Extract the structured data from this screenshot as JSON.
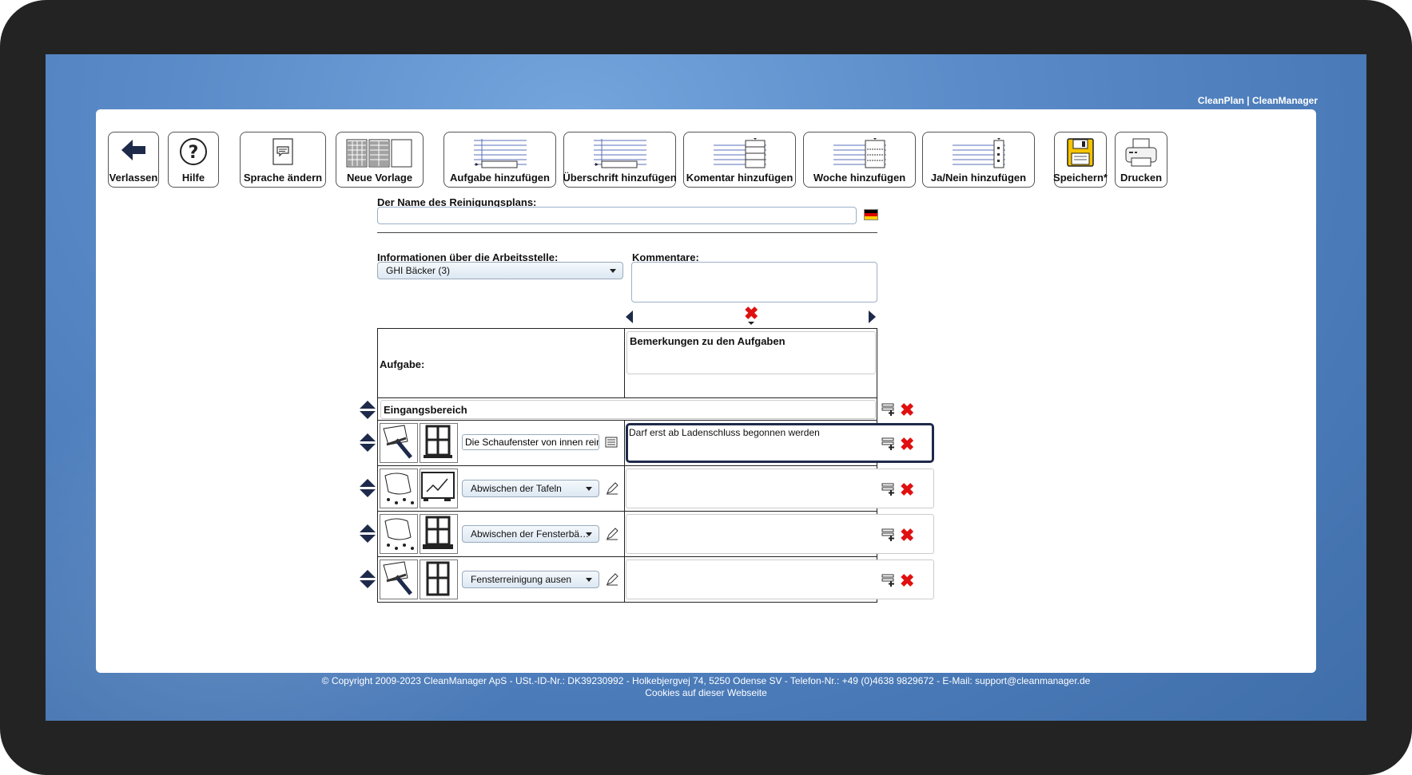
{
  "brand": "CleanPlan | CleanManager",
  "toolbar": {
    "leave": "Verlassen",
    "help": "Hilfe",
    "language": "Sprache ändern",
    "template": "Neue Vorlage",
    "add_task": "Aufgabe hinzufügen",
    "add_heading": "Überschrift hinzufügen",
    "add_comment": "Komentar hinzufügen",
    "add_week": "Woche hinzufügen",
    "add_yesno": "Ja/Nein hinzufügen",
    "save": "Speichern*",
    "print": "Drucken"
  },
  "form": {
    "plan_name_label": "Der Name des Reinigungsplans:",
    "plan_name_value": "",
    "workplace_label": "Informationen über die Arbeitsstelle:",
    "workplace_value": "GHI Bäcker (3)",
    "comments_label": "Kommentare:",
    "comments_value": ""
  },
  "grid": {
    "task_header": "Aufgabe:",
    "remarks_header": "Bemerkungen zu den Aufgaben",
    "section_title": "Eingangsbereich",
    "tasks": [
      {
        "name": "Die Schaufenster von innen reinig",
        "type": "text",
        "remark": "Darf erst ab Ladenschluss begonnen werden",
        "icon1": "squeegee-icon",
        "icon2": "window-cleaning-icon"
      },
      {
        "name": "Abwischen der Tafeln",
        "type": "select",
        "remark": "",
        "icon1": "wet-cloth-icon",
        "icon2": "whiteboard-icon"
      },
      {
        "name": "Abwischen der Fensterbä…",
        "type": "select",
        "remark": "",
        "icon1": "wet-cloth-icon",
        "icon2": "window-sill-icon"
      },
      {
        "name": "Fensterreinigung ausen",
        "type": "select",
        "remark": "",
        "icon1": "squeegee-icon",
        "icon2": "window-icon"
      }
    ]
  },
  "footer": {
    "copyright": "© Copyright 2009-2023 CleanManager ApS - USt.-ID-Nr.: DK39230992 - Holkebjergvej 74, 5250 Odense SV - Telefon-Nr.: +49 (0)4638 9829672 - E-Mail: support@cleanmanager.de",
    "cookies": "Cookies auf dieser Webseite"
  },
  "colors": {
    "screen_blue": "#5b8cc9",
    "delete_red": "#e01010",
    "navy": "#1e2a4a"
  }
}
